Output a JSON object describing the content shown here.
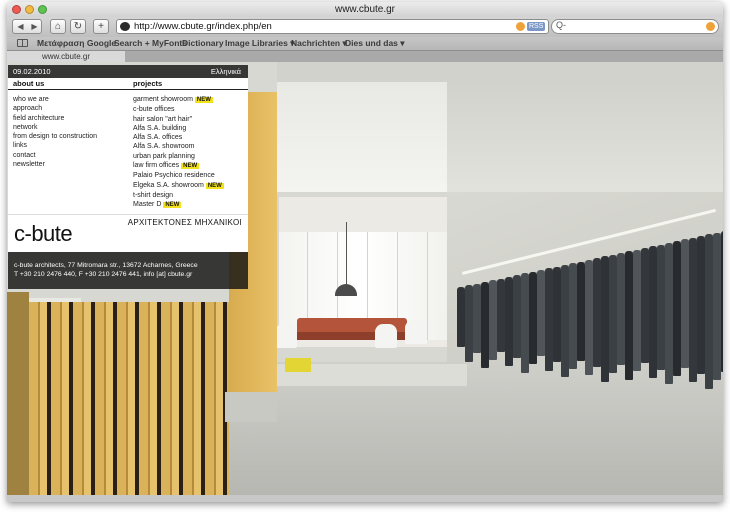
{
  "window": {
    "title": "www.cbute.gr"
  },
  "toolbar": {
    "url": "http://www.cbute.gr/index.php/en",
    "rss_label": "RSS",
    "search_placeholder": "Q-"
  },
  "bookmarks": [
    "Μετάφραση Google",
    "Search + MyFonts",
    "Dictionary",
    "Image Libraries ▾",
    "Nachrichten ▾",
    "Dies und das ▾"
  ],
  "tab": {
    "label": "www.cbute.gr"
  },
  "site": {
    "date": "09.02.2010",
    "language_link": "Ελληνικά",
    "about_header": "about us",
    "projects_header": "projects",
    "about_items": [
      "who we are",
      "approach",
      "field architecture",
      "network",
      "from design to construction",
      "links",
      "contact",
      "newsletter"
    ],
    "projects": [
      {
        "label": "garment showroom",
        "new": "NEW"
      },
      {
        "label": "c-bute offices",
        "new": ""
      },
      {
        "label": "hair salon \"art hair\"",
        "new": ""
      },
      {
        "label": "Alfa S.A. building",
        "new": ""
      },
      {
        "label": "Alfa S.A. offices",
        "new": ""
      },
      {
        "label": "Alfa S.A. showroom",
        "new": ""
      },
      {
        "label": "urban park planning",
        "new": ""
      },
      {
        "label": "law firm offices",
        "new": "NEW"
      },
      {
        "label": "Palaio Psychico residence",
        "new": ""
      },
      {
        "label": "Elgeka S.A. showroom",
        "new": "NEW"
      },
      {
        "label": "t-shirt design",
        "new": ""
      },
      {
        "label": "Master D",
        "new": "NEW"
      }
    ],
    "logo": "c-bute",
    "tagline": "ΑΡΧΙΤΕΚΤΟΝΕΣ ΜΗΧΑΝΙΚΟΙ",
    "address_line1": "c-bute architects, 77 Mitromara str., 13672 Acharnes, Greece",
    "address_line2": "T +30 210 2476 440, F +30 210 2476 441, info [at] cbute.gr"
  },
  "colors": {
    "new_badge": "#f1e21d",
    "panel_bg": "#141412",
    "wood": "#d9b25a"
  }
}
